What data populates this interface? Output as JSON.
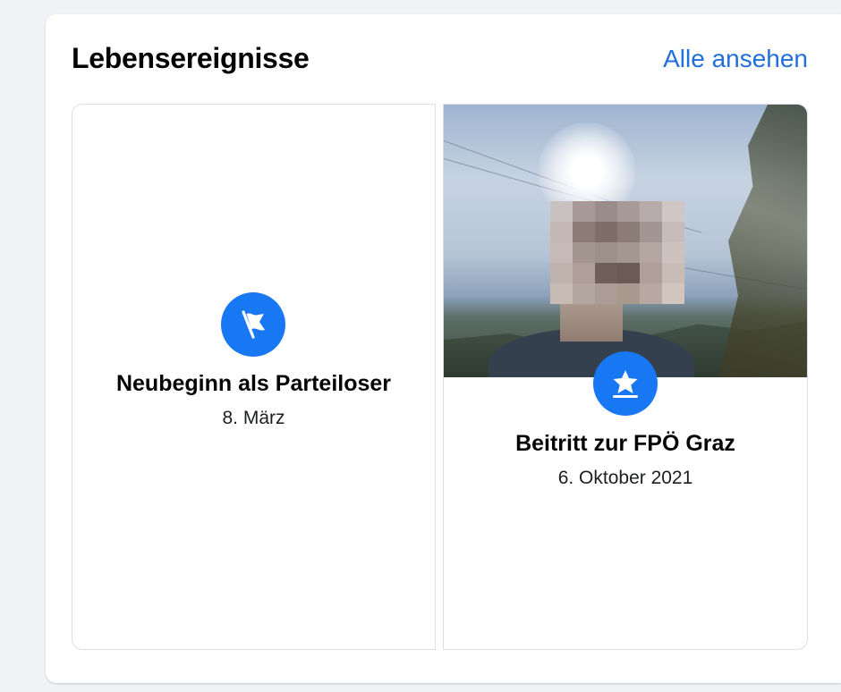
{
  "section": {
    "title": "Lebensereignisse",
    "see_all_label": "Alle ansehen"
  },
  "events": [
    {
      "title": "Neubeginn als Parteiloser",
      "date": "8. März",
      "icon": "flag-icon",
      "has_photo": false
    },
    {
      "title": "Beitritt zur FPÖ Graz",
      "date": "6. Oktober 2021",
      "icon": "star-icon",
      "has_photo": true
    }
  ],
  "colors": {
    "accent": "#1877f2",
    "link": "#216fdb",
    "background": "#f0f2f5",
    "card_border": "#dddfe2"
  }
}
